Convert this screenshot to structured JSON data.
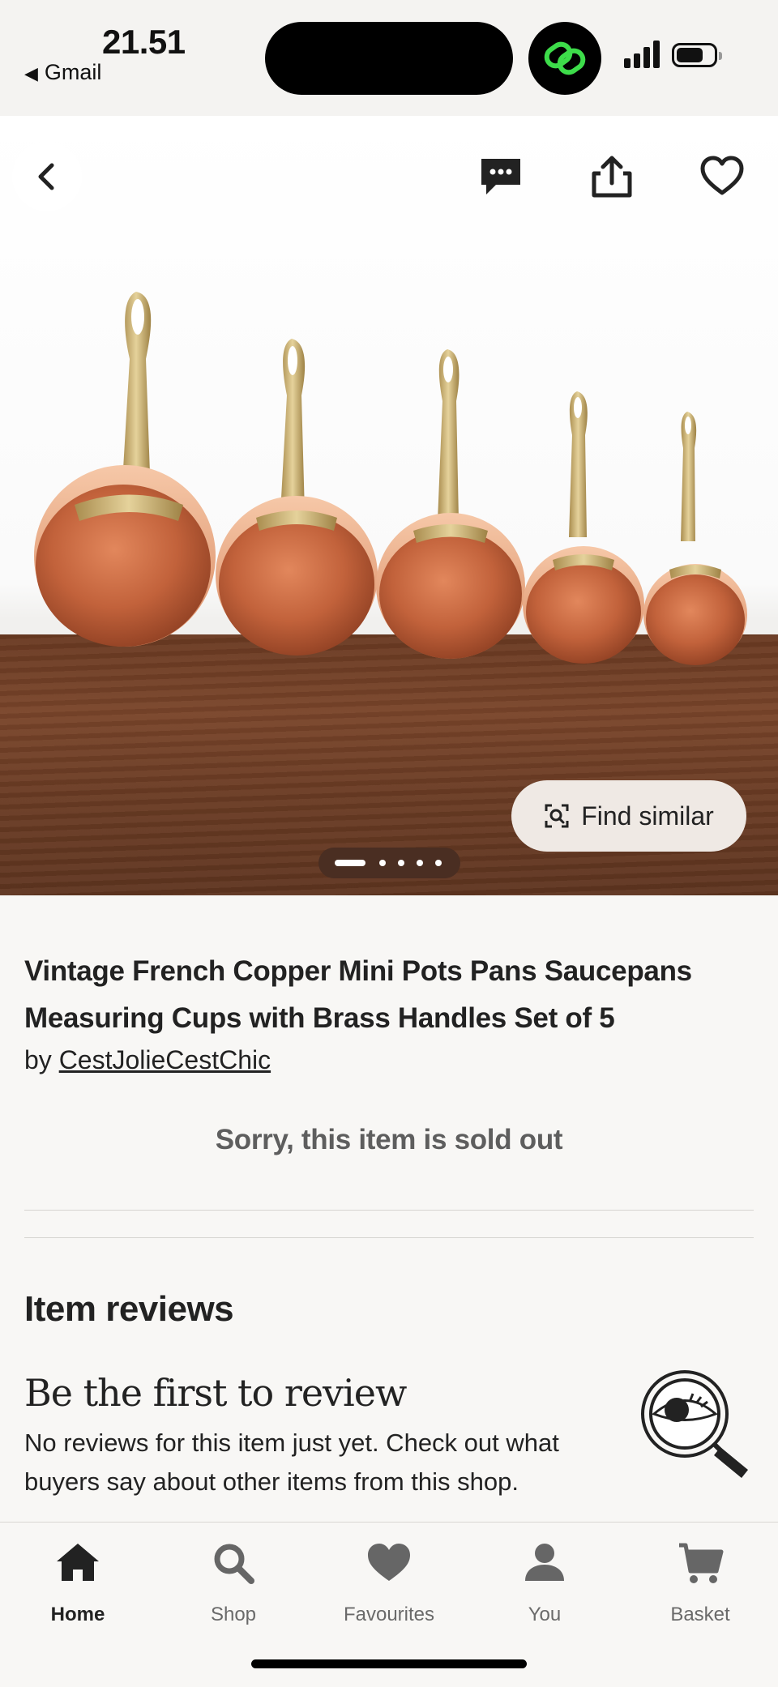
{
  "status_bar": {
    "time": "21.51",
    "back_app": "Gmail"
  },
  "hero": {
    "find_similar_label": "Find similar",
    "image_count": 5,
    "active_image_index": 0
  },
  "listing": {
    "title": "Vintage French Copper Mini Pots Pans Saucepans Measuring Cups with Brass Handles Set of 5",
    "by_prefix": "by",
    "shop_name": "CestJolieCestChic",
    "sold_out_text": "Sorry, this item is sold out"
  },
  "reviews": {
    "heading": "Item reviews",
    "empty_title": "Be the first to review",
    "empty_text": "No reviews for this item just yet. Check out what buyers say about other items from this shop."
  },
  "tabbar": {
    "items": [
      {
        "label": "Home",
        "icon": "home-icon",
        "active": true
      },
      {
        "label": "Shop",
        "icon": "search-icon",
        "active": false
      },
      {
        "label": "Favourites",
        "icon": "heart-icon",
        "active": false
      },
      {
        "label": "You",
        "icon": "person-icon",
        "active": false
      },
      {
        "label": "Basket",
        "icon": "cart-icon",
        "active": false
      }
    ]
  },
  "colors": {
    "background": "#f8f7f5",
    "copper": "#c8673f",
    "brass": "#c9b074",
    "wood": "#6b3c24"
  }
}
